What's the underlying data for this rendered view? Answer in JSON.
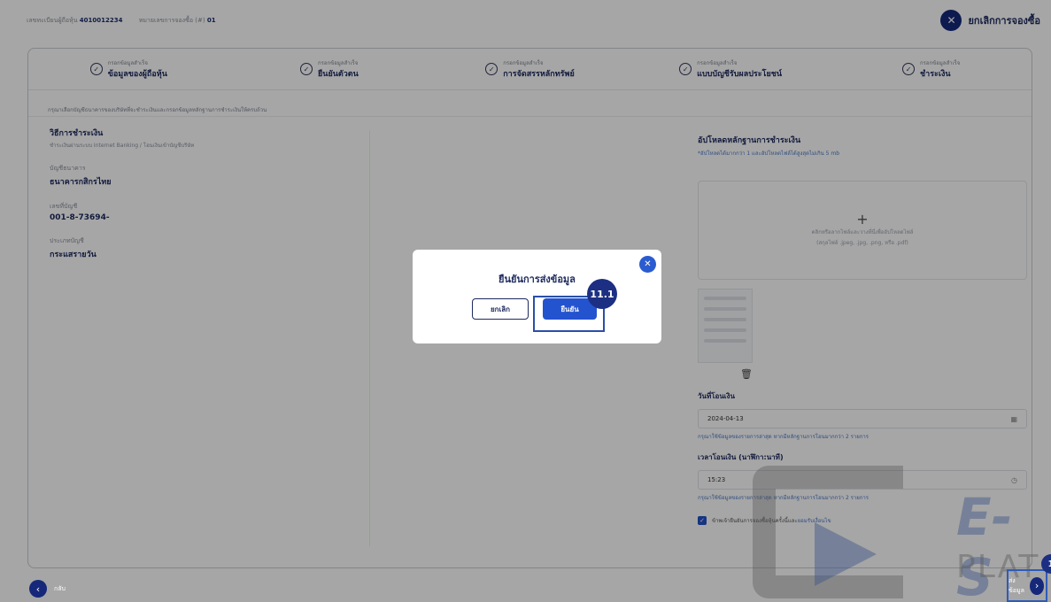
{
  "topbar": {
    "holder_label": "เลขทะเบียนผู้ถือหุ้น",
    "holder_no": "4010012234",
    "order_label": "หมายเลขการจองซื้อ (#)",
    "order_no": "01",
    "cancel_order": "ยกเลิกการจองซื้อ"
  },
  "steps": [
    {
      "sub": "กรอกข้อมูลสำเร็จ",
      "main": "ข้อมูลของผู้ถือหุ้น"
    },
    {
      "sub": "กรอกข้อมูลสำเร็จ",
      "main": "ยืนยันตัวตน"
    },
    {
      "sub": "กรอกข้อมูลสำเร็จ",
      "main": "การจัดสรรหลักทรัพย์"
    },
    {
      "sub": "กรอกข้อมูลสำเร็จ",
      "main": "แบบบัญชีรับผลประโยชน์"
    },
    {
      "sub": "กรอกข้อมูลสำเร็จ",
      "main": "ชำระเงิน"
    }
  ],
  "instruction": "กรุณาเลือกบัญชีธนาคารของบริษัทที่จะชำระเงินและกรอกข้อมูลหลักฐานการชำระเงินให้ครบถ้วน",
  "payment": {
    "method_title": "วิธีการชำระเงิน",
    "method_desc": "ชำระเงินผ่านระบบ Internet Banking / โอนเงินเข้าบัญชีบริษัท",
    "bank_label": "บัญชีธนาคาร",
    "bank_value": "ธนาคารกสิกรไทย",
    "account_label": "เลขที่บัญชี",
    "account_value": "001-8-73694-",
    "type_label": "ประเภทบัญชี",
    "type_value": "กระแสรายวัน"
  },
  "upload": {
    "title": "อัปโหลดหลักฐานการชำระเงิน",
    "note": "*อัปโหลดได้มากกว่า 1 และอัปโหลดไฟล์ได้สูงสุดไม่เกิน 5 mb",
    "plus": "+",
    "drop_text": "คลิกหรือลากไฟล์และวางที่นี่เพื่ออัปโหลดไฟล์",
    "formats": "(สกุลไฟล์ .jpeg, .jpg, .png, หรือ .pdf)"
  },
  "transfer_date": {
    "label": "วันที่โอนเงิน",
    "value": "2024-04-13",
    "hint": "กรุณาใช้ข้อมูลของรายการล่าสุด หากมีหลักฐานการโอนมากกว่า 2 รายการ"
  },
  "transfer_time": {
    "label": "เวลาโอนเงิน (นาฬิกา:นาที)",
    "value": "15:23",
    "hint": "กรุณาใช้ข้อมูลของรายการล่าสุด หากมีหลักฐานการโอนมากกว่า 2 รายการ"
  },
  "agree": {
    "text": "ข้าพเจ้ายืนยันการจองซื้อหุ้นครั้งนี้และ",
    "link": "ยอมรับเงื่อนไข"
  },
  "footer": {
    "back": "กลับ",
    "next": "ส่งข้อมูล",
    "edge_badge": "1"
  },
  "watermark": {
    "e": "E-S",
    "plat": "PLAT"
  },
  "modal": {
    "title": "ยืนยันการส่งข้อมูล",
    "cancel": "ยกเลิก",
    "confirm": "ยืนยัน",
    "badge": "11.1"
  },
  "colors": {
    "primary": "#15287a",
    "accent": "#2453cf",
    "text_dark": "#1d2a5e",
    "link": "#4a79c8"
  }
}
